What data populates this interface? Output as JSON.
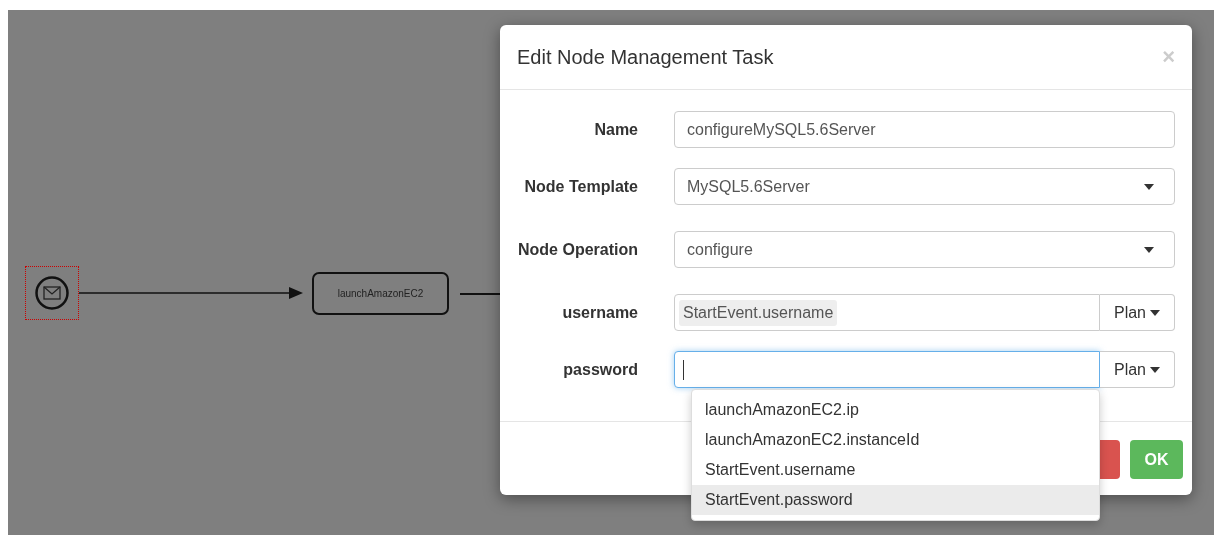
{
  "diagram": {
    "start_event": {
      "selected": true
    },
    "task": {
      "label": "launchAmazonEC2"
    }
  },
  "dialog": {
    "title": "Edit Node Management Task",
    "close": "×",
    "fields": [
      {
        "kind": "text",
        "label": "Name",
        "value": "configureMySQL5.6Server"
      },
      {
        "kind": "select",
        "label": "Node Template",
        "value": "MySQL5.6Server"
      },
      {
        "kind": "select",
        "label": "Node Operation",
        "value": "configure"
      },
      {
        "kind": "param",
        "label": "username",
        "token": "StartEvent.username",
        "focused": false,
        "addon": "Plan"
      },
      {
        "kind": "param",
        "label": "password",
        "focused": true,
        "addon": "Plan"
      }
    ],
    "suggestions": [
      {
        "label": "launchAmazonEC2.ip",
        "selected": false
      },
      {
        "label": "launchAmazonEC2.instanceId",
        "selected": false
      },
      {
        "label": "StartEvent.username",
        "selected": false
      },
      {
        "label": "StartEvent.password",
        "selected": true
      }
    ],
    "ok": "OK"
  }
}
